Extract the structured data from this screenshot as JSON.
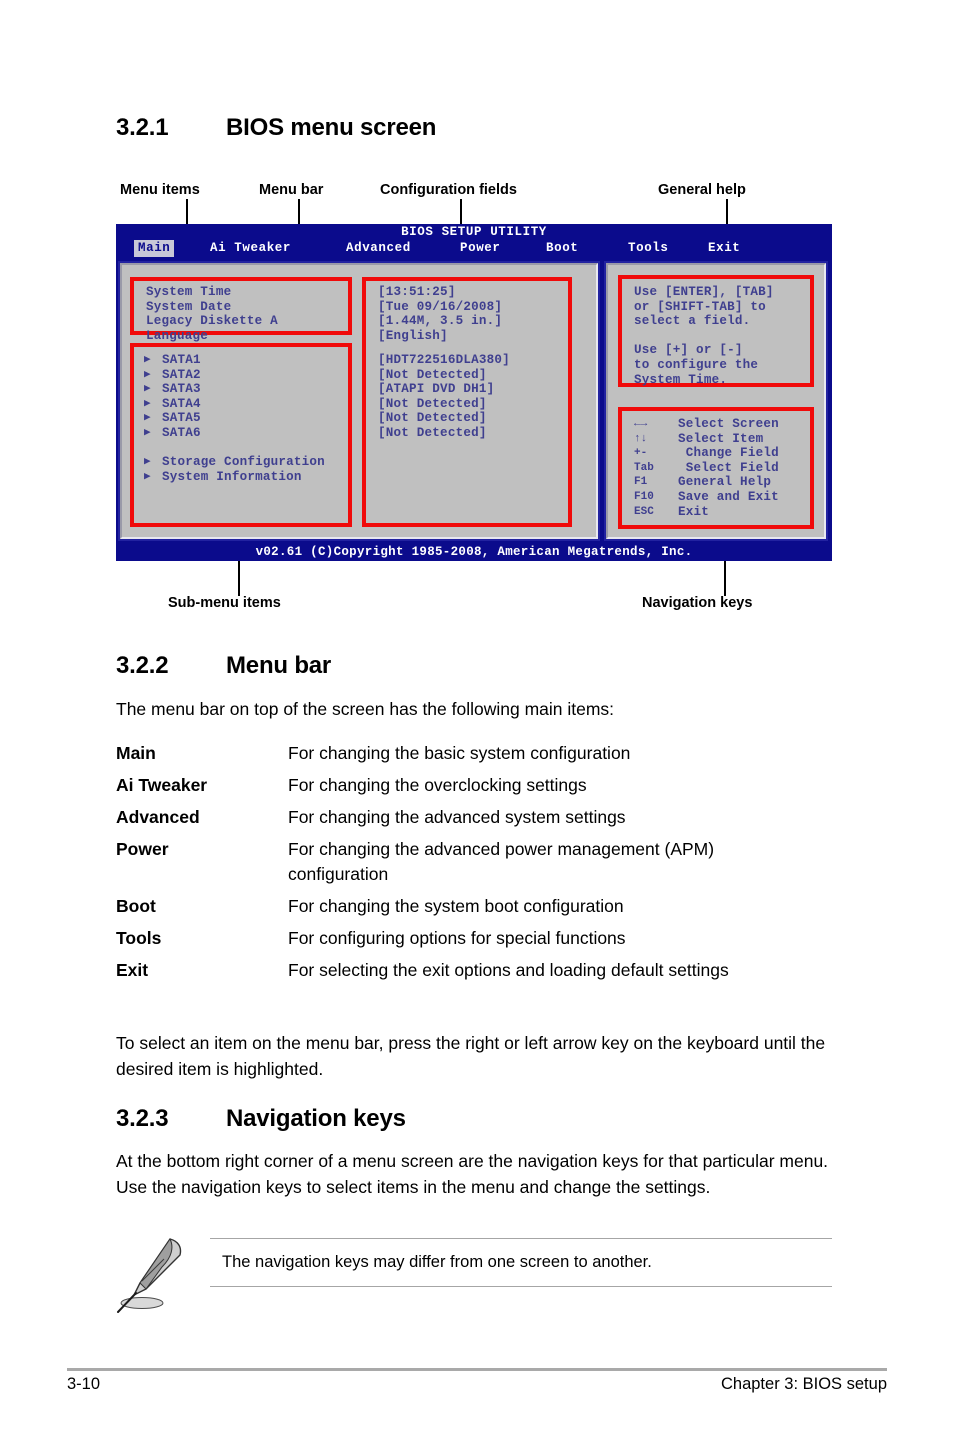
{
  "sections": {
    "s1": {
      "number": "3.2.1",
      "title": "BIOS menu screen"
    },
    "s2": {
      "number": "3.2.2",
      "title": "Menu bar"
    },
    "s3": {
      "number": "3.2.3",
      "title": "Navigation keys"
    }
  },
  "callouts": {
    "menu_items": "Menu items",
    "menu_bar": "Menu bar",
    "configuration_fields": "Configuration fields",
    "general_help": "General help",
    "sub_menu_items": "Sub-menu items",
    "navigation_keys": "Navigation keys"
  },
  "bios": {
    "title": "BIOS SETUP UTILITY",
    "tabs": [
      {
        "label": "Main",
        "active": true
      },
      {
        "label": "Ai Tweaker",
        "active": false
      },
      {
        "label": "Advanced",
        "active": false
      },
      {
        "label": "Power",
        "active": false
      },
      {
        "label": "Boot",
        "active": false
      },
      {
        "label": "Tools",
        "active": false
      },
      {
        "label": "Exit",
        "active": false
      }
    ],
    "menu_items_group1": "System Time\nSystem Date\nLegacy Diskette A\nLanguage",
    "menu_items_group2": "SATA1\nSATA2\nSATA3\nSATA4\nSATA5\nSATA6",
    "menu_items_group3": "Storage Configuration\nSystem Information",
    "submenu_arrows_group2": "▶\n▶\n▶\n▶\n▶\n▶",
    "submenu_arrows_group3": "▶\n▶",
    "config_fields_group1": "[13:51:25]\n[Tue 09/16/2008]\n[1.44M, 3.5 in.]\n[English]",
    "config_fields_group2": "[HDT722516DLA380]\n[Not Detected]\n[ATAPI DVD DH1]\n[Not Detected]\n[Not Detected]\n[Not Detected]",
    "help_text": "Use [ENTER], [TAB]\nor [SHIFT-TAB] to\nselect a field.\n\nUse [+] or [-]\nto configure the\nSystem Time.",
    "nav_keys_glyphs": "←→\n↑↓\n+-\nTab\nF1\nF10\nESC",
    "nav_keys_labels": "Select Screen\nSelect Item\n Change Field\n Select Field\nGeneral Help\nSave and Exit\nExit",
    "footer": "v02.61 (C)Copyright 1985-2008, American Megatrends, Inc.",
    "colors": {
      "background": "#0b0b8c",
      "panel": "#c0c0c0",
      "text": "#3f3f8f",
      "highlight_box": "#f00a0a",
      "active_tab_bg": "#c8c8d8"
    }
  },
  "menu_bar_intro": "The menu bar on top of the screen has the following main items:",
  "menu_bar_items": [
    {
      "term": "Main",
      "desc": "For changing the basic system configuration"
    },
    {
      "term": "Ai Tweaker",
      "desc": "For changing the overclocking settings"
    },
    {
      "term": "Advanced",
      "desc": "For changing the advanced system settings"
    },
    {
      "term": "Power",
      "desc": "For changing the advanced power management (APM) configuration"
    },
    {
      "term": "Boot",
      "desc": "For changing the system boot configuration"
    },
    {
      "term": "Tools",
      "desc": "For configuring options for special functions"
    },
    {
      "term": "Exit",
      "desc": "For selecting the exit options and loading default settings"
    }
  ],
  "paragraphs": {
    "select_item": "To select an item on the menu bar, press the right or left arrow key on the keyboard until the desired item is highlighted.",
    "nav_intro": "At the bottom right corner of a menu screen are the navigation keys for that particular menu. Use the navigation keys to select items in the menu and change the settings."
  },
  "note": {
    "text": "The navigation keys may differ from one screen to another."
  },
  "page_footer": {
    "page_number": "3-10",
    "chapter": "Chapter 3: BIOS setup"
  }
}
